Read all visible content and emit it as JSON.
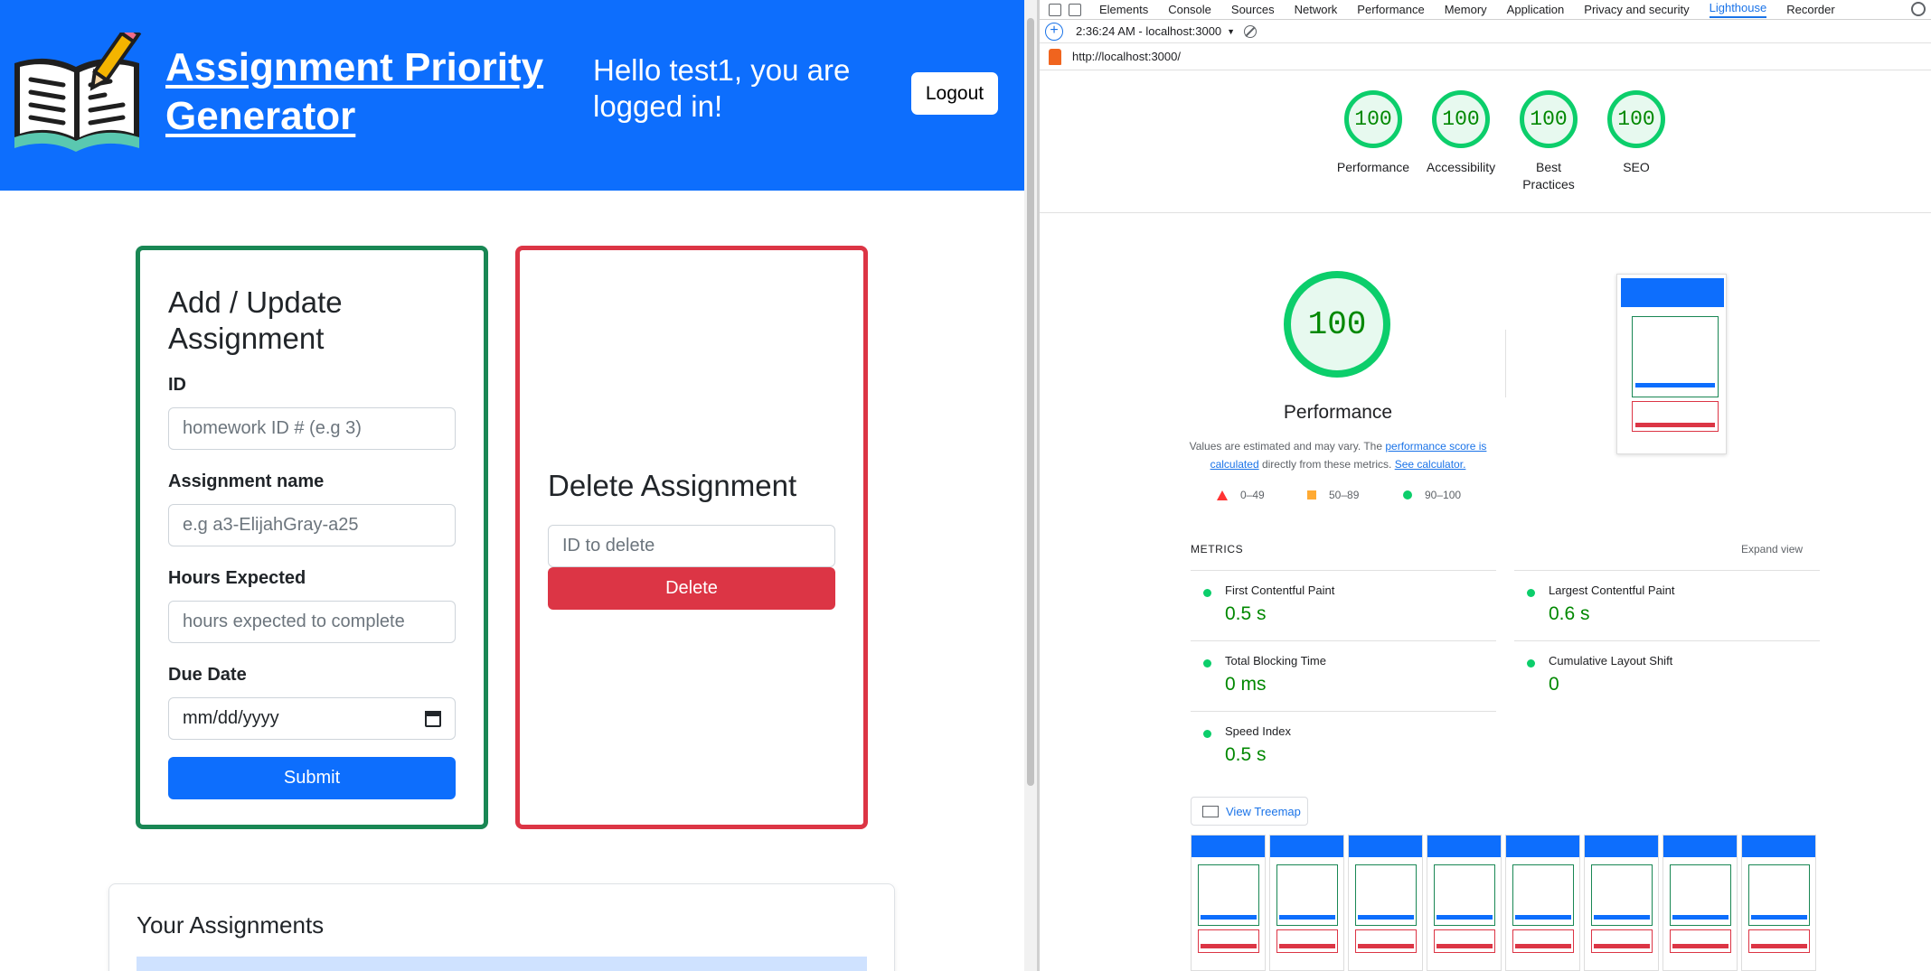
{
  "app": {
    "title": "Assignment Priority Generator",
    "greeting": "Hello test1, you are logged in!",
    "logout_label": "Logout",
    "add_card": {
      "title": "Add / Update Assignment",
      "id_label": "ID",
      "id_placeholder": "homework ID # (e.g 3)",
      "name_label": "Assignment name",
      "name_placeholder": "e.g a3-ElijahGray-a25",
      "hours_label": "Hours Expected",
      "hours_placeholder": "hours expected to complete",
      "due_label": "Due Date",
      "due_placeholder": "mm/dd/yyyy",
      "submit_label": "Submit"
    },
    "delete_card": {
      "title": "Delete Assignment",
      "id_placeholder": "ID to delete",
      "delete_label": "Delete"
    },
    "assignments_title": "Your Assignments",
    "colors": {
      "primary": "#0d6efd",
      "success": "#198754",
      "danger": "#dc3545"
    }
  },
  "devtools": {
    "tabs": [
      "Elements",
      "Console",
      "Sources",
      "Network",
      "Performance",
      "Memory",
      "Application",
      "Privacy and security",
      "Lighthouse",
      "Recorder"
    ],
    "active_tab": "Lighthouse",
    "report_time": "2:36:24 AM - localhost:3000",
    "url": "http://localhost:3000/",
    "scores": [
      {
        "label": "Performance",
        "score": "100"
      },
      {
        "label": "Accessibility",
        "score": "100"
      },
      {
        "label": "Best Practices",
        "score": "100"
      },
      {
        "label": "SEO",
        "score": "100"
      }
    ],
    "main_score": "100",
    "main_label": "Performance",
    "note_prefix": "Values are estimated and may vary. The",
    "note_link1": "performance score is calculated",
    "note_middle": "directly from these metrics.",
    "note_link2": "See calculator.",
    "legend": {
      "fail": "0–49",
      "average": "50–89",
      "pass": "90–100"
    },
    "metrics_heading": "METRICS",
    "expand_label": "Expand view",
    "metrics": [
      {
        "name": "First Contentful Paint",
        "value": "0.5 s"
      },
      {
        "name": "Largest Contentful Paint",
        "value": "0.6 s"
      },
      {
        "name": "Total Blocking Time",
        "value": "0 ms"
      },
      {
        "name": "Cumulative Layout Shift",
        "value": "0"
      },
      {
        "name": "Speed Index",
        "value": "0.5 s"
      }
    ],
    "treemap_label": "View Treemap",
    "colors": {
      "pass": "#0cce6b",
      "average": "#ffaa33",
      "fail": "#ff3333",
      "link": "#1a73e8"
    }
  }
}
